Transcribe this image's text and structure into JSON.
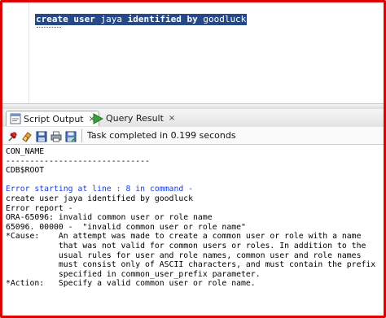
{
  "editor": {
    "sql_keywords": "create user",
    "sql_rest": " jaya ",
    "sql_kw2": "identified by",
    "sql_tail": " goodluck"
  },
  "tabs": [
    {
      "label": "Script Output",
      "close": "×",
      "icon": "script-output-icon"
    },
    {
      "label": "Query Result",
      "close": "×",
      "icon": "run-triangle-icon"
    }
  ],
  "toolbar": {
    "icons": [
      "pin-icon",
      "eraser-icon",
      "save-icon",
      "print-icon",
      "save-as-icon"
    ],
    "status": "Task completed in 0.199 seconds"
  },
  "output": {
    "lines": [
      {
        "text": "CON_NAME",
        "style": "normal"
      },
      {
        "text": "------------------------------",
        "style": "normal"
      },
      {
        "text": "CDB$ROOT",
        "style": "normal"
      },
      {
        "text": "",
        "style": "normal"
      },
      {
        "text": "Error starting at line : 8 in command -",
        "style": "blue"
      },
      {
        "text": "create user jaya identified by goodluck",
        "style": "normal"
      },
      {
        "text": "Error report -",
        "style": "normal"
      },
      {
        "text": "ORA-65096: invalid common user or role name",
        "style": "normal"
      },
      {
        "text": "65096. 00000 -  \"invalid common user or role name\"",
        "style": "normal"
      },
      {
        "text": "*Cause:    An attempt was made to create a common user or role with a name",
        "style": "normal"
      },
      {
        "text": "           that was not valid for common users or roles. In addition to the",
        "style": "normal"
      },
      {
        "text": "           usual rules for user and role names, common user and role names",
        "style": "normal"
      },
      {
        "text": "           must consist only of ASCII characters, and must contain the prefix",
        "style": "normal"
      },
      {
        "text": "           specified in common_user_prefix parameter.",
        "style": "normal"
      },
      {
        "text": "*Action:   Specify a valid common user or role name.",
        "style": "normal"
      }
    ]
  },
  "colors": {
    "frame_border": "#e00000",
    "selection": "#254a87",
    "error_blue": "#1a3fd6"
  }
}
